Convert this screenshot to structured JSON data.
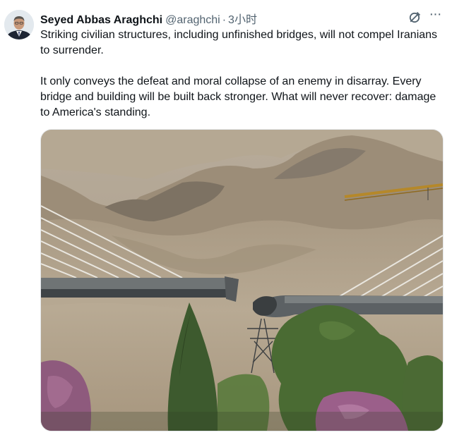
{
  "tweet": {
    "author_name": "Seyed Abbas Araghchi",
    "handle": "@araghchi",
    "separator": "·",
    "time": "3小时",
    "paragraphs": [
      "Striking civilian structures, including unfinished bridges, will not compel Iranians to surrender.",
      "It only conveys the defeat and moral collapse of an enemy in disarray. Every bridge and building will be built back stronger. What will never recover: damage to America's standing."
    ],
    "icons": {
      "grok": "grok-icon",
      "more": "more-options-icon"
    }
  }
}
